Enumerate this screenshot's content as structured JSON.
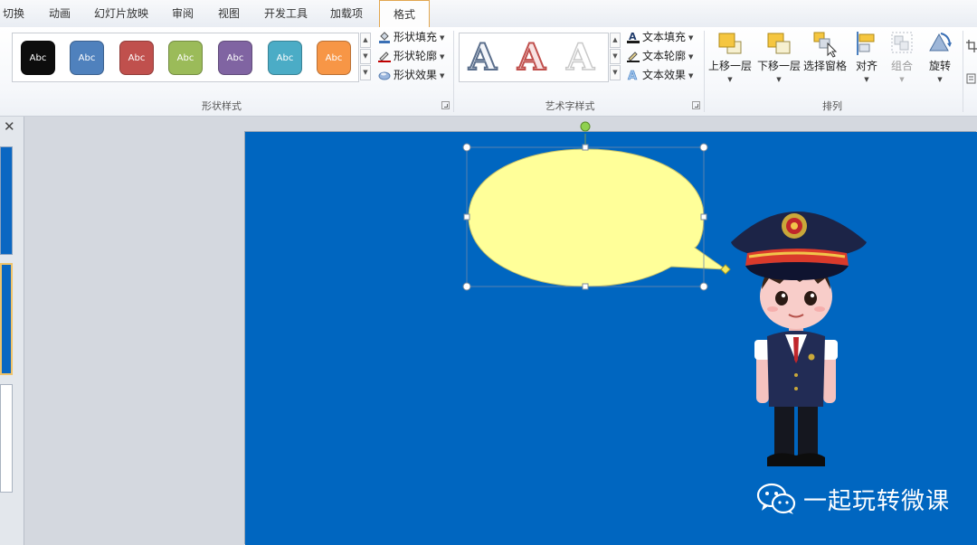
{
  "tabs": [
    "切换",
    "动画",
    "幻灯片放映",
    "审阅",
    "视图",
    "开发工具",
    "加载项",
    "格式"
  ],
  "active_tab": "格式",
  "shape_styles": {
    "swatch_label": "Abc",
    "swatch_colors": [
      "#0d0d0d",
      "#4f81bd",
      "#c0504d",
      "#9bbb59",
      "#8064a2",
      "#4bacc6",
      "#f79646"
    ],
    "shape_fill": "形状填充",
    "shape_outline": "形状轮廓",
    "shape_effects": "形状效果",
    "group_label": "形状样式"
  },
  "wordart_styles": {
    "sample_letter": "A",
    "text_fill": "文本填充",
    "text_outline": "文本轮廓",
    "text_effects": "文本效果",
    "group_label": "艺术字样式"
  },
  "arrange": {
    "bring_forward": "上移一层",
    "send_backward": "下移一层",
    "selection_pane": "选择窗格",
    "align": "对齐",
    "group": "组合",
    "rotate": "旋转",
    "group_label": "排列"
  },
  "slide": {
    "background_color": "#0066c0",
    "callout_fill": "#ffff99",
    "watermark_text": "一起玩转微课"
  }
}
